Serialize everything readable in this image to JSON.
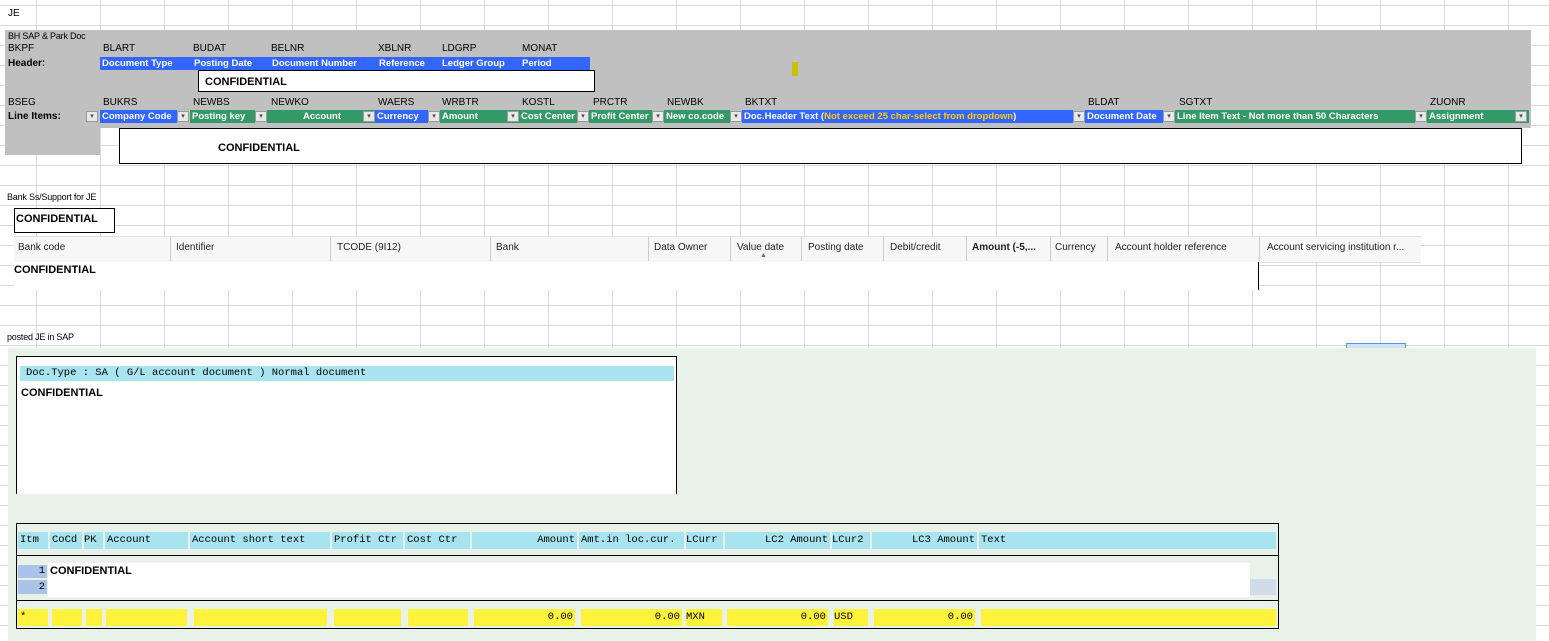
{
  "sheet_title": "JE",
  "sap_section": {
    "title": "BH SAP & Park Doc",
    "bkpf": "BKPF",
    "header_label": "Header:",
    "header_codes": [
      "BLART",
      "BUDAT",
      "BELNR",
      "XBLNR",
      "LDGRP",
      "MONAT"
    ],
    "header_fields": [
      "Document Type",
      "Posting Date",
      "Document Number",
      "Reference",
      "Ledger Group",
      "Period"
    ],
    "header_confidential": "CONFIDENTIAL",
    "bseg": "BSEG",
    "line_items_label": "Line Items:",
    "line_codes": [
      "BUKRS",
      "NEWBS",
      "NEWKO",
      "WAERS",
      "WRBTR",
      "KOSTL",
      "PRCTR",
      "NEWBK",
      "BKTXT",
      "BLDAT",
      "SGTXT",
      "ZUONR"
    ],
    "line_fields": [
      "Company Code",
      "Posting key",
      "Account",
      "Currency",
      "Amount",
      "Cost Center",
      "Profit Center",
      "New co.code",
      "Doc.Header Text (",
      "Document Date",
      "Line Item Text - Not more than 50 Characters",
      "Assignment"
    ],
    "bktxt_note": "Not exceed 25 char-select from dropdown",
    "bktxt_close": ")",
    "line_confidential": "CONFIDENTIAL",
    "colors": {
      "blue": "#3366ff",
      "green": "#339966",
      "note": "#ffcc00",
      "gray": "#c0c0c0"
    }
  },
  "bank_section": {
    "title": "Bank Ss/Support for JE",
    "confidential_box": "CONFIDENTIAL",
    "columns": [
      "Bank code",
      "Identifier",
      "TCODE  (9I12)",
      "Bank",
      "Data Owner",
      "Value date",
      "Posting date",
      "Debit/credit",
      "Amount  (-5,...",
      "Currency",
      "Account holder reference",
      "Account servicing institution r..."
    ],
    "sort_indicator": "▲",
    "row_confidential": "CONFIDENTIAL"
  },
  "posted_section": {
    "title": "posted JE in SAP",
    "doc_type": "Doc.Type : SA ( G/L account document ) Normal document",
    "doc_confidential": "CONFIDENTIAL",
    "columns": [
      "Itm",
      "CoCd",
      "PK",
      "Account",
      "Account short text",
      "Profit Ctr",
      "Cost Ctr",
      "Amount",
      "Amt.in loc.cur.",
      "LCurr",
      "LC2 Amount",
      "LCur2",
      "LC3 Amount",
      "Text"
    ],
    "rows": [
      "1",
      "2"
    ],
    "rows_confidential": "CONFIDENTIAL",
    "totals": {
      "marker": "*",
      "amount": "0.00",
      "amt_loc": "0.00",
      "lcurr": "MXN",
      "lc2": "0.00",
      "lcur2": "USD",
      "lc3": "0.00"
    }
  }
}
